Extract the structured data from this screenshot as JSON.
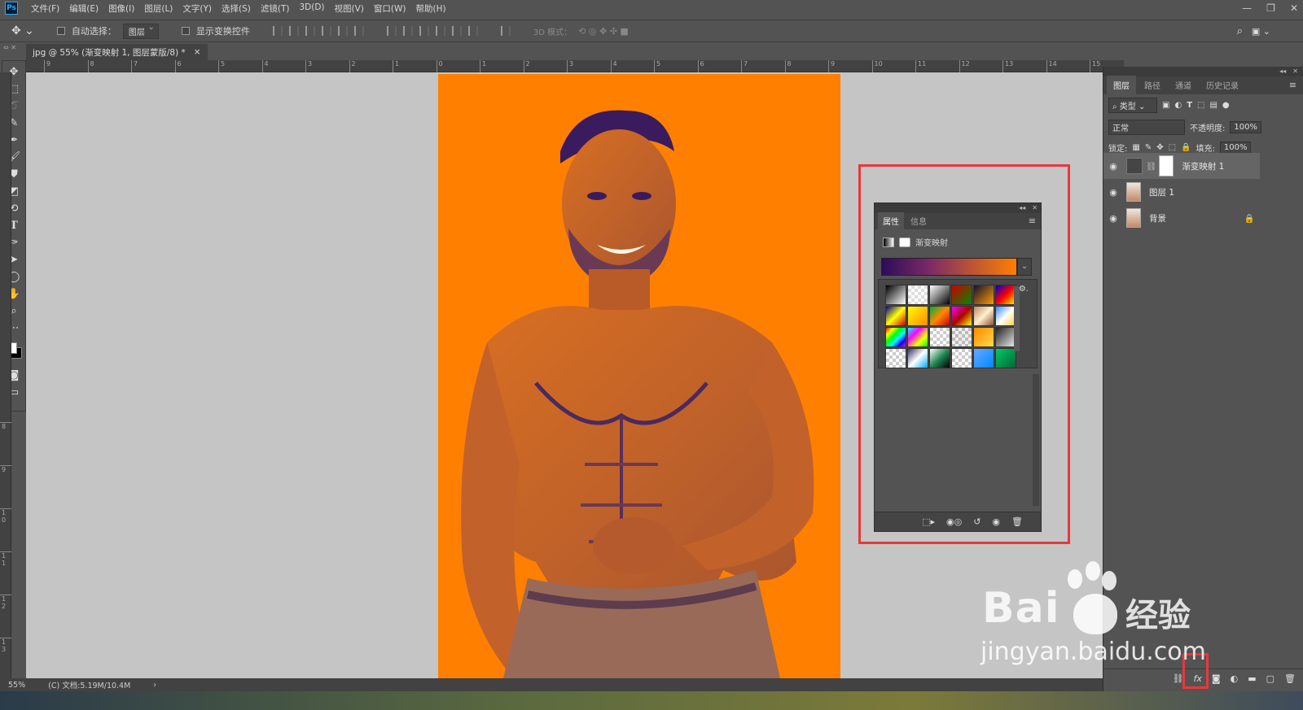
{
  "menubar": {
    "logo": "Ps",
    "items": [
      "文件(F)",
      "编辑(E)",
      "图像(I)",
      "图层(L)",
      "文字(Y)",
      "选择(S)",
      "滤镜(T)",
      "3D(D)",
      "视图(V)",
      "窗口(W)",
      "帮助(H)"
    ],
    "window_controls": [
      "—",
      "❐",
      "✕"
    ]
  },
  "options": {
    "auto_select_label": "自动选择：",
    "auto_select_value": "图层",
    "show_transform_label": "显示变换控件",
    "mode_3d_label": "3D 模式："
  },
  "document": {
    "tab_title": "jpg @ 55% (渐变映射 1, 图层蒙版/8) *",
    "tab_close": "×"
  },
  "rulers": {
    "top": [
      "9",
      "8",
      "7",
      "6",
      "5",
      "4",
      "3",
      "2",
      "1",
      "0",
      "1",
      "2",
      "3",
      "4",
      "5",
      "6",
      "7",
      "8",
      "9",
      "10",
      "11",
      "12",
      "13",
      "14",
      "15"
    ],
    "left": [
      "8",
      "9",
      "1 0",
      "1 1",
      "1 2",
      "1 3"
    ]
  },
  "properties": {
    "tabs": [
      "属性",
      "信息"
    ],
    "active_tab": "属性",
    "adjustment_name": "渐变映射",
    "gradient_stops": [
      "#2b0c5a",
      "#ff7f00"
    ],
    "gradient_presets": [
      "linear-gradient(135deg,#000,#fff)",
      "repeating-conic-gradient(#ddd 0 25%,#fff 0 50%) 0 0/8px 8px",
      "linear-gradient(135deg,#fff,#000)",
      "linear-gradient(135deg,#c00,#080)",
      "linear-gradient(135deg,#113,#f90)",
      "linear-gradient(135deg,#00c,#f00,#ff0)",
      "linear-gradient(135deg,#009,#ff0,#c00)",
      "linear-gradient(135deg,#ff0,#f80)",
      "linear-gradient(135deg,#0a3,#f80,#c00)",
      "linear-gradient(135deg,#f0f,#a00,#ff0)",
      "linear-gradient(135deg,#b86,#fec,#853)",
      "linear-gradient(135deg,#38f,#fff,#fc3)",
      "linear-gradient(135deg,#f00,#ff0,#0f0,#0ff,#00f,#f0f)",
      "linear-gradient(135deg,#0ff,#f0f,#ff0,#0f0)",
      "repeating-conic-gradient(#ccc 0 25%,#fff 0 50%) 0 0/8px 8px",
      "repeating-conic-gradient(#bbb 0 25%,#eee 0 50%) 0 0/8px 8px",
      "linear-gradient(135deg,#f80,#fd4)",
      "linear-gradient(135deg,#222,#eee)",
      "repeating-conic-gradient(#ccc 0 25%,#fff 0 50%) 0 0/8px 8px",
      "linear-gradient(135deg,#336,#fff,#0af)",
      "linear-gradient(135deg,#fff,#285,#000)",
      "repeating-conic-gradient(#ccc 0 25%,#fff 0 50%) 0 0/8px 8px",
      "linear-gradient(135deg,#6af,#08f)",
      "linear-gradient(135deg,#0c6,#063)"
    ]
  },
  "layers_panel": {
    "tabs": [
      "图层",
      "路径",
      "通道",
      "历史记录"
    ],
    "active_tab": "图层",
    "filter_label": "类型",
    "blend_mode": "正常",
    "opacity_label": "不透明度:",
    "opacity_value": "100%",
    "lock_label": "锁定:",
    "fill_label": "填充:",
    "fill_value": "100%",
    "layers": [
      {
        "name": "渐变映射 1",
        "selected": true
      },
      {
        "name": "图层 1",
        "selected": false
      },
      {
        "name": "背景",
        "selected": false
      }
    ]
  },
  "status": {
    "zoom": "55%",
    "doc_info": "(C) 文档:5.19M/10.4M"
  },
  "colors": {
    "highlight": "#e8383d",
    "photo_orange": "#ff8000",
    "photo_purple": "#3a1b5e"
  },
  "watermark": {
    "brand": "Bai",
    "brand_suffix": "经验",
    "url": "jingyan.baidu.com"
  }
}
